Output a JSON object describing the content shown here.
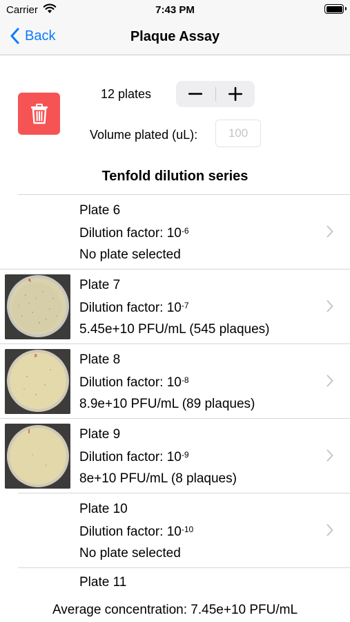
{
  "status_bar": {
    "carrier": "Carrier",
    "time": "7:43 PM"
  },
  "nav": {
    "back_label": "Back",
    "title": "Plaque Assay"
  },
  "controls": {
    "plates_label": "12 plates",
    "volume_label": "Volume plated (uL):",
    "volume_placeholder": "100",
    "volume_value": ""
  },
  "section_title": "Tenfold dilution series",
  "dilution_prefix": "Dilution factor: 10",
  "plates": [
    {
      "name": "Plate 6",
      "exponent": "-6",
      "result": "No plate selected",
      "has_image": false
    },
    {
      "name": "Plate 7",
      "exponent": "-7",
      "result": "5.45e+10 PFU/mL (545 plaques)",
      "has_image": true
    },
    {
      "name": "Plate 8",
      "exponent": "-8",
      "result": "8.9e+10 PFU/mL (89 plaques)",
      "has_image": true
    },
    {
      "name": "Plate 9",
      "exponent": "-9",
      "result": "8e+10 PFU/mL (8 plaques)",
      "has_image": true
    },
    {
      "name": "Plate 10",
      "exponent": "-10",
      "result": "No plate selected",
      "has_image": false
    }
  ],
  "partial_plate": {
    "name": "Plate 11"
  },
  "average": "Average concentration: 7.45e+10 PFU/mL",
  "colors": {
    "accent": "#0a7aff",
    "delete": "#f65454"
  },
  "icons": [
    "wifi-icon",
    "battery-icon",
    "chevron-left-icon",
    "trash-icon",
    "minus-icon",
    "plus-icon",
    "chevron-right-icon"
  ]
}
